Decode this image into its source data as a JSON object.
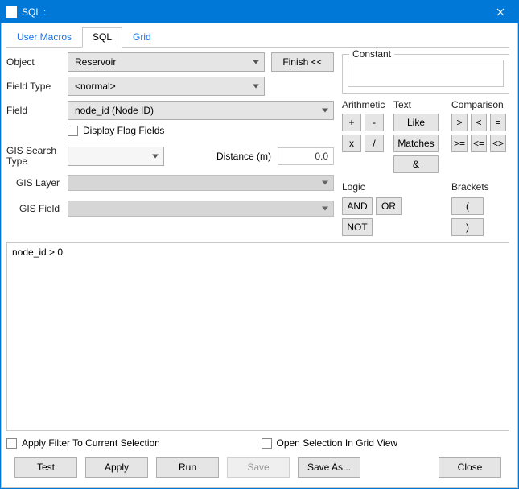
{
  "window": {
    "title": "SQL :"
  },
  "tabs": {
    "user_macros": "User Macros",
    "sql": "SQL",
    "grid": "Grid"
  },
  "form": {
    "object_label": "Object",
    "object_value": "Reservoir",
    "finish": "Finish <<",
    "field_type_label": "Field Type",
    "field_type_value": "<normal>",
    "field_label": "Field",
    "field_value": "node_id  (Node ID)",
    "display_flag": "Display Flag Fields",
    "gis_search_type_label": "GIS Search Type",
    "distance_label": "Distance (m)",
    "distance_value": "0.0",
    "gis_layer_label": "GIS Layer",
    "gis_field_label": "GIS Field"
  },
  "constant": {
    "legend": "Constant"
  },
  "ops": {
    "arith": "Arithmetic",
    "text": "Text",
    "comp": "Comparison",
    "plus": "+",
    "minus": "-",
    "mul": "x",
    "div": "/",
    "like": "Like",
    "matches": "Matches",
    "amp": "&",
    "gt": ">",
    "lt": "<",
    "eq": "=",
    "gte": ">=",
    "lte": "<=",
    "neq": "<>",
    "logic": "Logic",
    "brackets": "Brackets",
    "and": "AND",
    "or": "OR",
    "not": "NOT",
    "lp": "(",
    "rp": ")"
  },
  "sql": {
    "text": "node_id > 0"
  },
  "footer": {
    "apply_filter": "Apply Filter To Current Selection",
    "open_grid": "Open Selection In Grid View",
    "test": "Test",
    "apply": "Apply",
    "run": "Run",
    "save": "Save",
    "saveas": "Save As...",
    "close": "Close"
  }
}
